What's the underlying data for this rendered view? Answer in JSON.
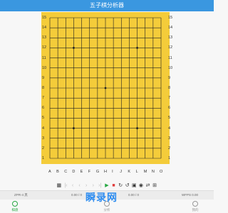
{
  "app": {
    "title": "五子棋分析器"
  },
  "board": {
    "row_labels": [
      "15",
      "14",
      "13",
      "12",
      "11",
      "10",
      "9",
      "8",
      "7",
      "6",
      "5",
      "4",
      "3",
      "2",
      "1"
    ],
    "col_labels": [
      "A",
      "B",
      "C",
      "D",
      "E",
      "F",
      "G",
      "H",
      "I",
      "J",
      "K",
      "L",
      "M",
      "N",
      "O"
    ],
    "star_points": [
      "D12",
      "L12",
      "H8",
      "D4",
      "L4"
    ],
    "background_color": "#f4cc3a",
    "line_color": "#222222"
  },
  "toolbar": {
    "buttons": [
      "document-icon",
      "first-icon",
      "prev-icon",
      "prev-icon",
      "next-icon",
      "next-icon",
      "last-icon",
      "play-icon",
      "stop-icon",
      "refresh-icon",
      "replay-icon",
      "image-icon",
      "info-icon",
      "swap-icon",
      "settings-icon"
    ]
  },
  "statusbar": {
    "left": "ZPR-4 黑",
    "center": "0.00 / 0",
    "right": "0.00 / 0",
    "far_right": "WFPS 0.00"
  },
  "tabbar": {
    "tab_home": "棋盘",
    "tab_center": "分析",
    "tab_right": "我的"
  },
  "watermark": {
    "text": "瞬录网"
  }
}
